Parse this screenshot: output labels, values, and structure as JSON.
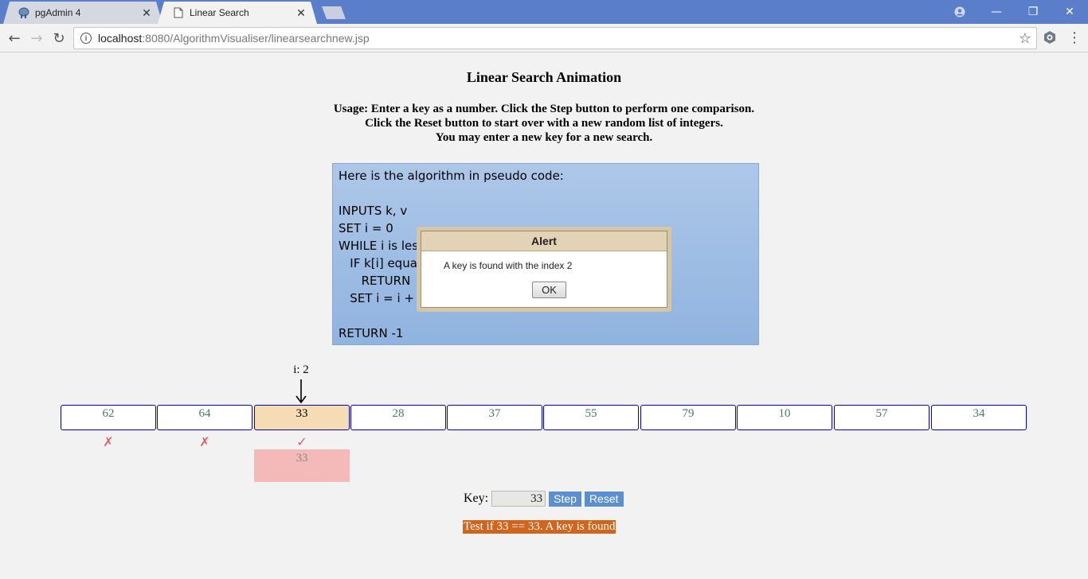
{
  "browser": {
    "tabs": [
      {
        "title": "pgAdmin 4",
        "active": false,
        "icon": "elephant-icon"
      },
      {
        "title": "Linear Search",
        "active": true,
        "icon": "document-icon"
      }
    ],
    "url_host": "localhost",
    "url_path": ":8080/AlgorithmVisualiser/linearsearchnew.jsp"
  },
  "page": {
    "title": "Linear Search Animation",
    "usage_lines": [
      "Usage: Enter a key as a number. Click the Step button to perform one comparison.",
      "Click the Reset button to start over with a new random list of integers.",
      "You may enter a new key for a new search."
    ],
    "pseudocode": [
      "Here is the algorithm in pseudo code:",
      "",
      "INPUTS k, v",
      "SET i = 0",
      "WHILE i is les",
      "   IF k[i] equa",
      "      RETURN",
      "   SET i = i + 1",
      "",
      "RETURN -1"
    ],
    "index_label": "i: 2",
    "array": [
      "62",
      "64",
      "33",
      "28",
      "37",
      "55",
      "79",
      "10",
      "57",
      "34"
    ],
    "current_index": 2,
    "marks": [
      "✗",
      "✗",
      "✓"
    ],
    "compare_value": "33",
    "key_label": "Key:",
    "key_value": "33",
    "step_label": "Step",
    "reset_label": "Reset",
    "status_text": "Test if 33 == 33. A key is found"
  },
  "alert": {
    "title": "Alert",
    "message": "A key is found with the index 2",
    "ok_label": "OK"
  },
  "colors": {
    "titlebar": "#5a7ec9",
    "cell_border": "#0000d0",
    "current_cell": "#f5dcb4",
    "compare_box": "#f4baba",
    "status_bg": "#d0651e",
    "button_blue": "#5b8fcf"
  }
}
